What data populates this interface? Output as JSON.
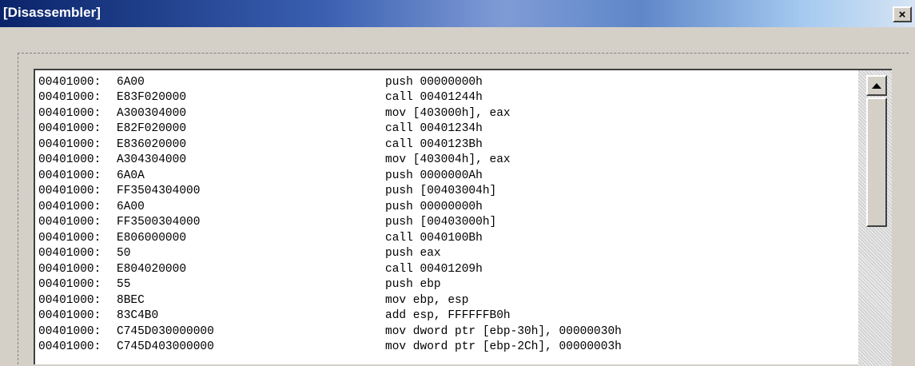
{
  "window": {
    "title": "[Disassembler]",
    "close_glyph": "×"
  },
  "listing": [
    {
      "address": "00401000:",
      "bytes": "6A00",
      "instruction": "push 00000000h"
    },
    {
      "address": "00401000:",
      "bytes": "E83F020000",
      "instruction": "call 00401244h"
    },
    {
      "address": "00401000:",
      "bytes": "A300304000",
      "instruction": "mov [403000h], eax"
    },
    {
      "address": "00401000:",
      "bytes": "E82F020000",
      "instruction": "call 00401234h"
    },
    {
      "address": "00401000:",
      "bytes": "E836020000",
      "instruction": "call 0040123Bh"
    },
    {
      "address": "00401000:",
      "bytes": "A304304000",
      "instruction": "mov [403004h], eax"
    },
    {
      "address": "00401000:",
      "bytes": "6A0A",
      "instruction": "push 0000000Ah"
    },
    {
      "address": "00401000:",
      "bytes": "FF3504304000",
      "instruction": "push [00403004h]"
    },
    {
      "address": "00401000:",
      "bytes": "6A00",
      "instruction": "push 00000000h"
    },
    {
      "address": "00401000:",
      "bytes": "FF3500304000",
      "instruction": "push [00403000h]"
    },
    {
      "address": "00401000:",
      "bytes": "E806000000",
      "instruction": "call 0040100Bh"
    },
    {
      "address": "00401000:",
      "bytes": "50",
      "instruction": "push eax"
    },
    {
      "address": "00401000:",
      "bytes": "E804020000",
      "instruction": "call 00401209h"
    },
    {
      "address": "00401000:",
      "bytes": "55",
      "instruction": "push ebp"
    },
    {
      "address": "00401000:",
      "bytes": "8BEC",
      "instruction": "mov ebp, esp"
    },
    {
      "address": "00401000:",
      "bytes": "83C4B0",
      "instruction": "add esp, FFFFFFB0h"
    },
    {
      "address": "00401000:",
      "bytes": "C745D030000000",
      "instruction": "mov dword ptr [ebp-30h], 00000030h"
    },
    {
      "address": "00401000:",
      "bytes": "C745D403000000",
      "instruction": "mov dword ptr [ebp-2Ch], 00000003h"
    }
  ],
  "icons": {
    "close": "close-icon",
    "scroll_up": "arrow-up-icon"
  }
}
